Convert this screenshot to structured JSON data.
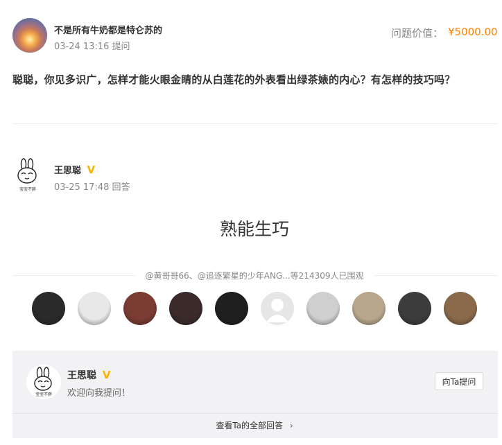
{
  "asker": {
    "name": "不是所有牛奶都是特仑苏的",
    "time": "03-24 13:16 提问"
  },
  "price": {
    "label": "问题价值：",
    "value": "¥5000.00"
  },
  "question": "聪聪，你见多识广，怎样才能火眼金睛的从白莲花的外表看出绿茶婊的内心？有怎样的技巧吗？",
  "answerer": {
    "name": "王思聪",
    "verified_badge": "V",
    "time": "03-25 17:48 回答",
    "avatar_caption": "宝宝不胖"
  },
  "answer": "熟能生巧",
  "viewers": {
    "summary": "@黄哥哥66、@追逐繁星的少年ANG...等214309人已围观",
    "avatar_tones": [
      "#2a2a2a",
      "#e8e8e8",
      "#7a3b32",
      "#3a2a2a",
      "#1f1f1f",
      "#d9d9d9",
      "#cfcfcf",
      "#b8a78c",
      "#3c3c3c",
      "#8a6a4a"
    ]
  },
  "footer": {
    "name": "王思聪",
    "verified_badge": "V",
    "welcome": "欢迎向我提问！",
    "ask_button": "向Ta提问",
    "view_all": "查看Ta的全部回答",
    "view_all_chevron": "›",
    "avatar_caption": "宝宝不胖"
  },
  "colors": {
    "accent_price": "#ff8200",
    "verified": "#f6b400",
    "footer_bg": "#f2f2f5"
  }
}
